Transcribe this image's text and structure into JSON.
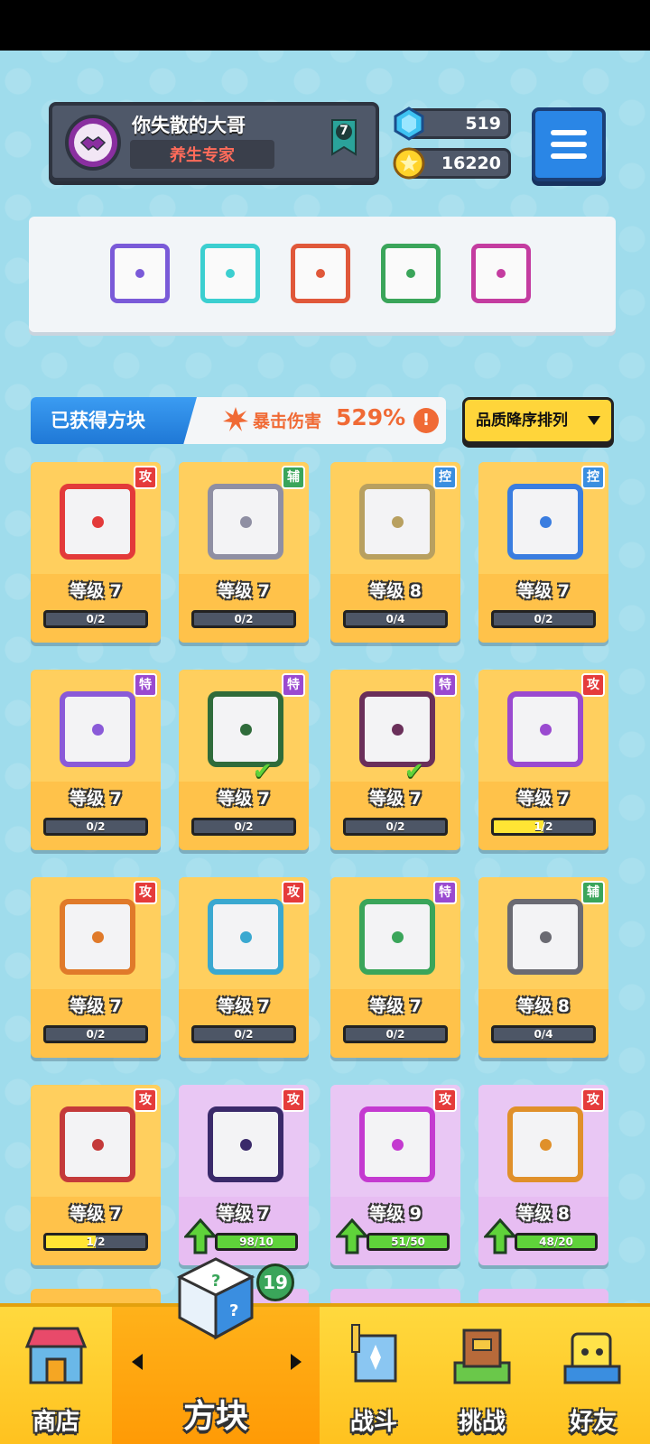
{
  "player": {
    "name": "你失散的大哥",
    "title": "养生专家",
    "level": "7"
  },
  "currency": {
    "gems": "519",
    "gold": "16220"
  },
  "equipped": [
    {
      "name": "slot-1",
      "color": "#7a5ad8"
    },
    {
      "name": "slot-2",
      "color": "#3ccfd0"
    },
    {
      "name": "slot-3",
      "color": "#e0583a"
    },
    {
      "name": "slot-4",
      "color": "#3aa55a"
    },
    {
      "name": "slot-5",
      "color": "#c43ca0"
    }
  ],
  "collection": {
    "label": "已获得方块",
    "crit_label": "暴击伤害",
    "crit_value": "529%",
    "info": "!",
    "sort_label": "品质降序排列"
  },
  "cards": [
    {
      "tag": "攻",
      "tag_type": "atk",
      "level": "等级 7",
      "progress": "0/2",
      "fill": 0,
      "color": "#e33a3a",
      "style": "gold"
    },
    {
      "tag": "辅",
      "tag_type": "sup",
      "level": "等级 7",
      "progress": "0/2",
      "fill": 0,
      "color": "#8f8fa3",
      "style": "gold"
    },
    {
      "tag": "控",
      "tag_type": "ctl",
      "level": "等级 8",
      "progress": "0/4",
      "fill": 0,
      "color": "#b8a060",
      "style": "gold"
    },
    {
      "tag": "控",
      "tag_type": "ctl",
      "level": "等级 7",
      "progress": "0/2",
      "fill": 0,
      "color": "#3a7de0",
      "style": "gold"
    },
    {
      "tag": "特",
      "tag_type": "spc",
      "level": "等级 7",
      "progress": "0/2",
      "fill": 0,
      "color": "#8a5ad8",
      "style": "gold"
    },
    {
      "tag": "特",
      "tag_type": "spc",
      "level": "等级 7",
      "progress": "0/2",
      "fill": 0,
      "color": "#2f6b3a",
      "style": "gold",
      "check": "✔"
    },
    {
      "tag": "特",
      "tag_type": "spc",
      "level": "等级 7",
      "progress": "0/2",
      "fill": 0,
      "color": "#6a2f5a",
      "style": "gold",
      "check": "✔"
    },
    {
      "tag": "攻",
      "tag_type": "atk",
      "level": "等级 7",
      "progress": "1/2",
      "fill": 0.5,
      "color": "#9a4ad0",
      "style": "gold"
    },
    {
      "tag": "攻",
      "tag_type": "atk",
      "level": "等级 7",
      "progress": "0/2",
      "fill": 0,
      "color": "#e07a2a",
      "style": "gold"
    },
    {
      "tag": "攻",
      "tag_type": "atk",
      "level": "等级 7",
      "progress": "0/2",
      "fill": 0,
      "color": "#3aa8d0",
      "style": "gold"
    },
    {
      "tag": "特",
      "tag_type": "spc",
      "level": "等级 7",
      "progress": "0/2",
      "fill": 0,
      "color": "#3aa55a",
      "style": "gold"
    },
    {
      "tag": "辅",
      "tag_type": "sup",
      "level": "等级 8",
      "progress": "0/4",
      "fill": 0,
      "color": "#6a6a72",
      "style": "gold"
    },
    {
      "tag": "攻",
      "tag_type": "atk",
      "level": "等级 7",
      "progress": "1/2",
      "fill": 0.5,
      "color": "#c43a3a",
      "style": "gold"
    },
    {
      "tag": "攻",
      "tag_type": "atk",
      "level": "等级 7",
      "progress": "98/10",
      "fill": 1,
      "color": "#3a2a6a",
      "style": "purple",
      "upgrade": true
    },
    {
      "tag": "攻",
      "tag_type": "atk",
      "level": "等级 9",
      "progress": "51/50",
      "fill": 1,
      "color": "#c43ad0",
      "style": "purple",
      "upgrade": true
    },
    {
      "tag": "攻",
      "tag_type": "atk",
      "level": "等级 8",
      "progress": "48/20",
      "fill": 1,
      "color": "#e0902a",
      "style": "purple",
      "upgrade": true
    }
  ],
  "nav": {
    "shop": "商店",
    "dice": "方块",
    "battle": "战斗",
    "challenge": "挑战",
    "friends": "好友",
    "dice_badge": "19"
  }
}
